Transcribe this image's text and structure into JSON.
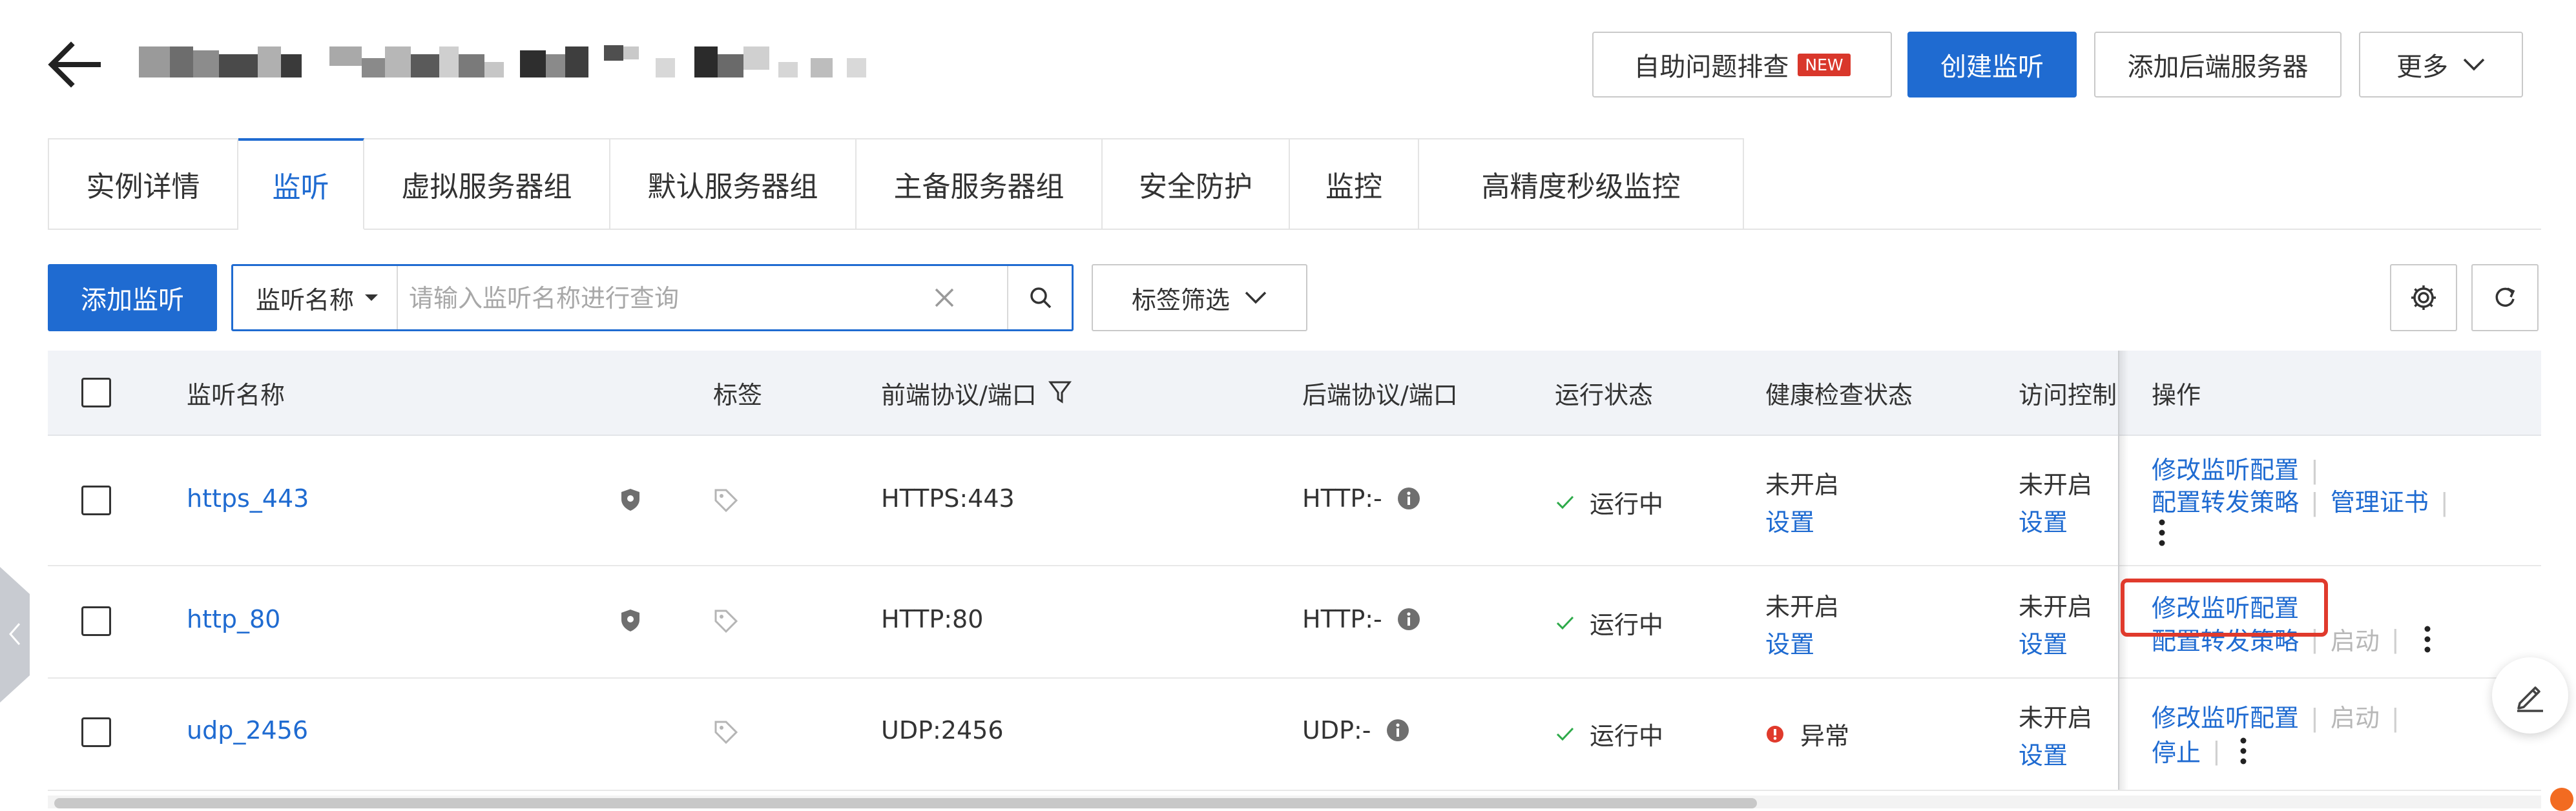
{
  "header": {
    "buttons": {
      "self_diagnose": "自助问题排查",
      "self_diagnose_badge": "NEW",
      "create_listener": "创建监听",
      "add_backend": "添加后端服务器",
      "more": "更多"
    }
  },
  "tabs": [
    "实例详情",
    "监听",
    "虚拟服务器组",
    "默认服务器组",
    "主备服务器组",
    "安全防护",
    "监控",
    "高精度秒级监控"
  ],
  "active_tab": "监听",
  "toolbar": {
    "add_listener": "添加监听",
    "search_field": "监听名称",
    "search_placeholder": "请输入监听名称进行查询",
    "tag_filter": "标签筛选"
  },
  "table": {
    "columns": {
      "name": "监听名称",
      "tag": "标签",
      "frontend": "前端协议/端口",
      "backend": "后端协议/端口",
      "status": "运行状态",
      "health": "健康检查状态",
      "acl": "访问控制",
      "ops": "操作"
    },
    "rows": [
      {
        "name": "https_443",
        "frontend": "HTTPS:443",
        "backend": "HTTP:-",
        "status": "运行中",
        "health": "未开启",
        "health_link": "设置",
        "acl": "未开启",
        "acl_link": "设置",
        "ops": {
          "a": "修改监听配置",
          "b": "配置转发策略",
          "c": "管理证书"
        }
      },
      {
        "name": "http_80",
        "frontend": "HTTP:80",
        "backend": "HTTP:-",
        "status": "运行中",
        "health": "未开启",
        "health_link": "设置",
        "acl": "未开启",
        "acl_link": "设置",
        "ops": {
          "a": "修改监听配置",
          "b": "配置转发策略",
          "c": "启动"
        }
      },
      {
        "name": "udp_2456",
        "frontend": "UDP:2456",
        "backend": "UDP:-",
        "status": "运行中",
        "health": "异常",
        "acl": "未开启",
        "acl_link": "设置",
        "ops": {
          "a": "修改监听配置",
          "b": "启动",
          "c": "停止"
        }
      }
    ]
  },
  "colors": {
    "primary": "#1f6bd1",
    "badge": "#d9372b",
    "success": "#2eaa4a",
    "error": "#e03a2c",
    "highlight": "#e03a2c"
  }
}
